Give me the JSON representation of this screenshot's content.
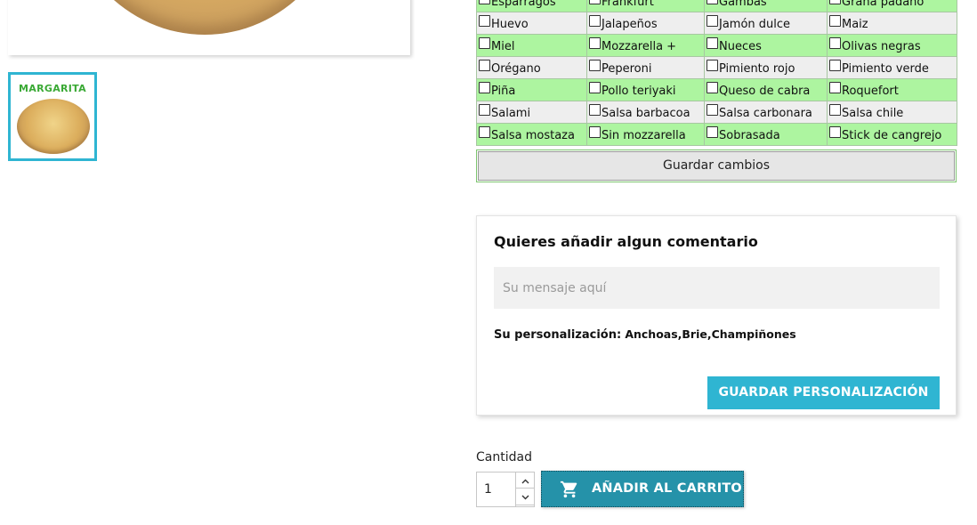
{
  "product": {
    "thumbnail_title": "MARGARITA"
  },
  "ingredients": {
    "rows": [
      [
        "Espárragos",
        "Frankfurt",
        "Gambas",
        "Grana padano"
      ],
      [
        "Huevo",
        "Jalapeños",
        "Jamón dulce",
        "Maiz"
      ],
      [
        "Miel",
        "Mozzarella +",
        "Nueces",
        "Olivas negras"
      ],
      [
        "Orégano",
        "Peperoni",
        "Pimiento rojo",
        "Pimiento verde"
      ],
      [
        "Piña",
        "Pollo teriyaki",
        "Queso de cabra",
        "Roquefort"
      ],
      [
        "Salami",
        "Salsa barbacoa",
        "Salsa carbonara",
        "Salsa chile"
      ],
      [
        "Salsa mostaza",
        "Sin mozzarella",
        "Sobrasada",
        "Stick de cangrejo"
      ]
    ],
    "save_label": "Guardar cambios"
  },
  "customization": {
    "title": "Quieres añadir algun comentario",
    "message_placeholder": "Su mensaje aquí",
    "message_value": "",
    "perso_label": "Su personalización:",
    "perso_value": "Anchoas,Brie,Champiñones",
    "save_label": "GUARDAR PERSONALIZACIÓN"
  },
  "purchase": {
    "quantity_label": "Cantidad",
    "quantity_value": "1",
    "add_to_cart_label": "AÑADIR AL CARRITO"
  },
  "colors": {
    "accent": "#2fb5d2",
    "cart_button": "#2592a9",
    "row_green": "#adf5a0",
    "row_gray": "#eeeeee",
    "thumb_title": "#3aa935"
  },
  "icons": {
    "cart": "shopping-cart-icon",
    "qty_up": "chevron-up-icon",
    "qty_down": "chevron-down-icon"
  }
}
